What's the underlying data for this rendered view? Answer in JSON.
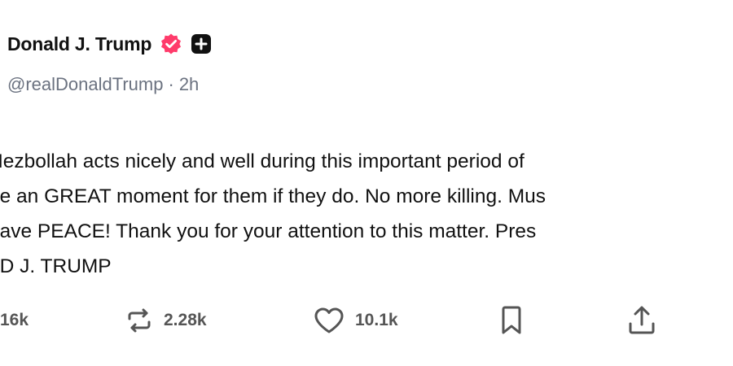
{
  "author": {
    "display_name": "Donald J. Trump",
    "handle": "@realDonaldTrump",
    "separator": "·",
    "time_ago": "2h"
  },
  "post": {
    "lines": [
      "Hezbollah acts nicely and well during this important period of",
      "be an GREAT moment for them if they do. No more killing. Mus",
      "have PEACE! Thank you for your attention to this matter. Pres",
      "LD J. TRUMP"
    ]
  },
  "actions": {
    "replies": "16k",
    "reposts": "2.28k",
    "likes": "10.1k"
  },
  "colors": {
    "verified_badge": "#ff3b6b",
    "text": "#111111",
    "muted": "#6b7280",
    "icon": "#555555"
  },
  "icons": {
    "verified": "verified-badge-icon",
    "follow": "plus-square-icon",
    "repost": "repost-icon",
    "like": "heart-icon",
    "bookmark": "bookmark-icon",
    "share": "share-icon"
  }
}
